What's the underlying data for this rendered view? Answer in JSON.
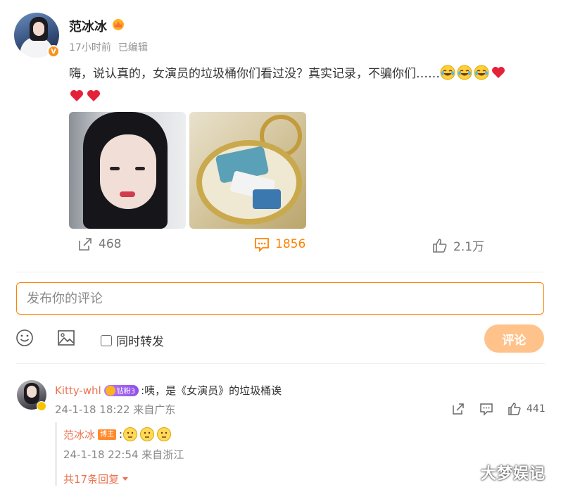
{
  "post": {
    "author": "范冰冰",
    "time": "17小时前",
    "edited": "已编辑",
    "text_main": "嗨，说认真的，女演员的垃圾桶你们看过没？真实记录，不骗你们……",
    "emojis_line1": [
      "laugh-cry-emoji",
      "laugh-cry-emoji",
      "laugh-cry-emoji",
      "heart-emoji"
    ],
    "emojis_line2": [
      "heart-emoji",
      "heart-emoji"
    ],
    "images": [
      "selfie-photo",
      "trash-bin-photo"
    ],
    "shares": "468",
    "comments": "1856",
    "likes": "2.1万"
  },
  "composer": {
    "placeholder": "发布你的评论",
    "repost_label": "同时转发",
    "submit_label": "评论",
    "icons": [
      "smiley-icon",
      "image-icon"
    ]
  },
  "comment": {
    "user": "Kitty-whl",
    "fan_badge": "钻粉3",
    "text": ":咦，是《女演员》的垃圾桶诶",
    "meta": "24-1-18 18:22 来自广东",
    "likes": "441"
  },
  "reply": {
    "user": "范冰冰",
    "host_badge": "博主",
    "text_prefix": ":",
    "emojis": [
      "thinking-emoji",
      "thinking-emoji",
      "thinking-emoji"
    ],
    "meta": "24-1-18 22:54 来自浙江",
    "more": "共17条回复"
  },
  "watermark": "大梦娱记",
  "colors": {
    "accent": "#ff8200",
    "username": "#eb7350",
    "submit_disabled": "#ffc28a"
  }
}
